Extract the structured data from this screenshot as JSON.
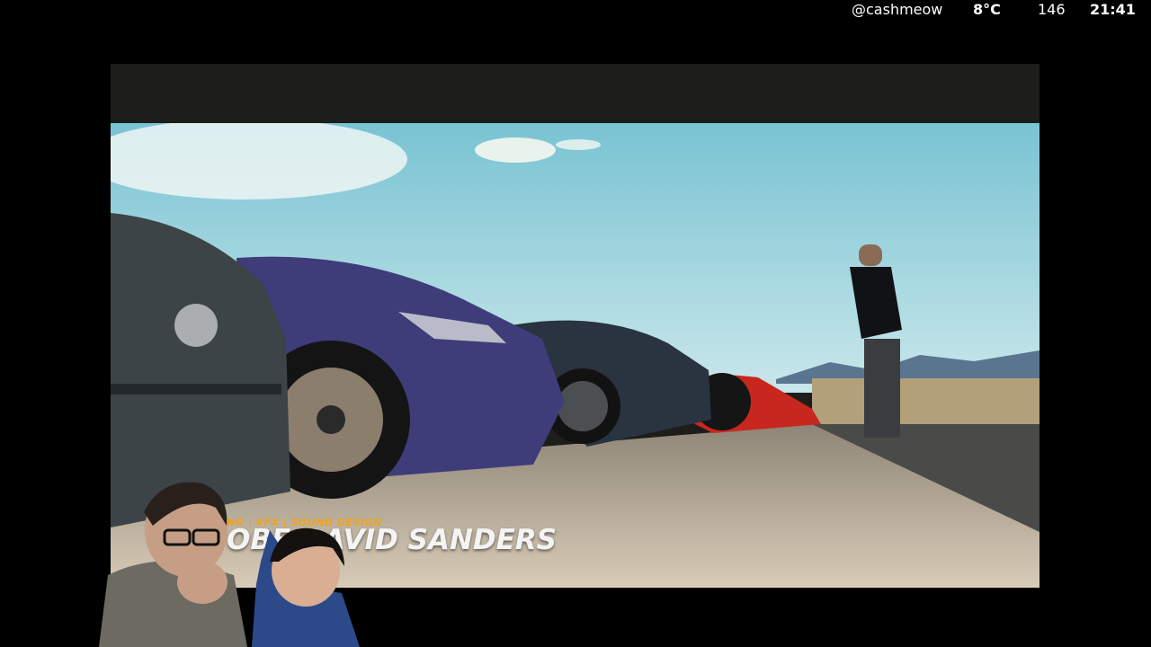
{
  "status_bar": {
    "handle": "@cashmeow",
    "temperature": "8°C",
    "count": "146",
    "time": "21:41"
  },
  "video": {
    "credit_role": "NG | VFX | SOUND DESIGN",
    "credit_name": "OBE   DAVID SANDERS",
    "channel_mark": "##### ||"
  },
  "colors": {
    "sky": "#8fd0dd",
    "ground": "#cdbfa8",
    "car_blue": "#3f3c7a",
    "car_red": "#c8271f",
    "credit_orange": "#f0a21a"
  }
}
